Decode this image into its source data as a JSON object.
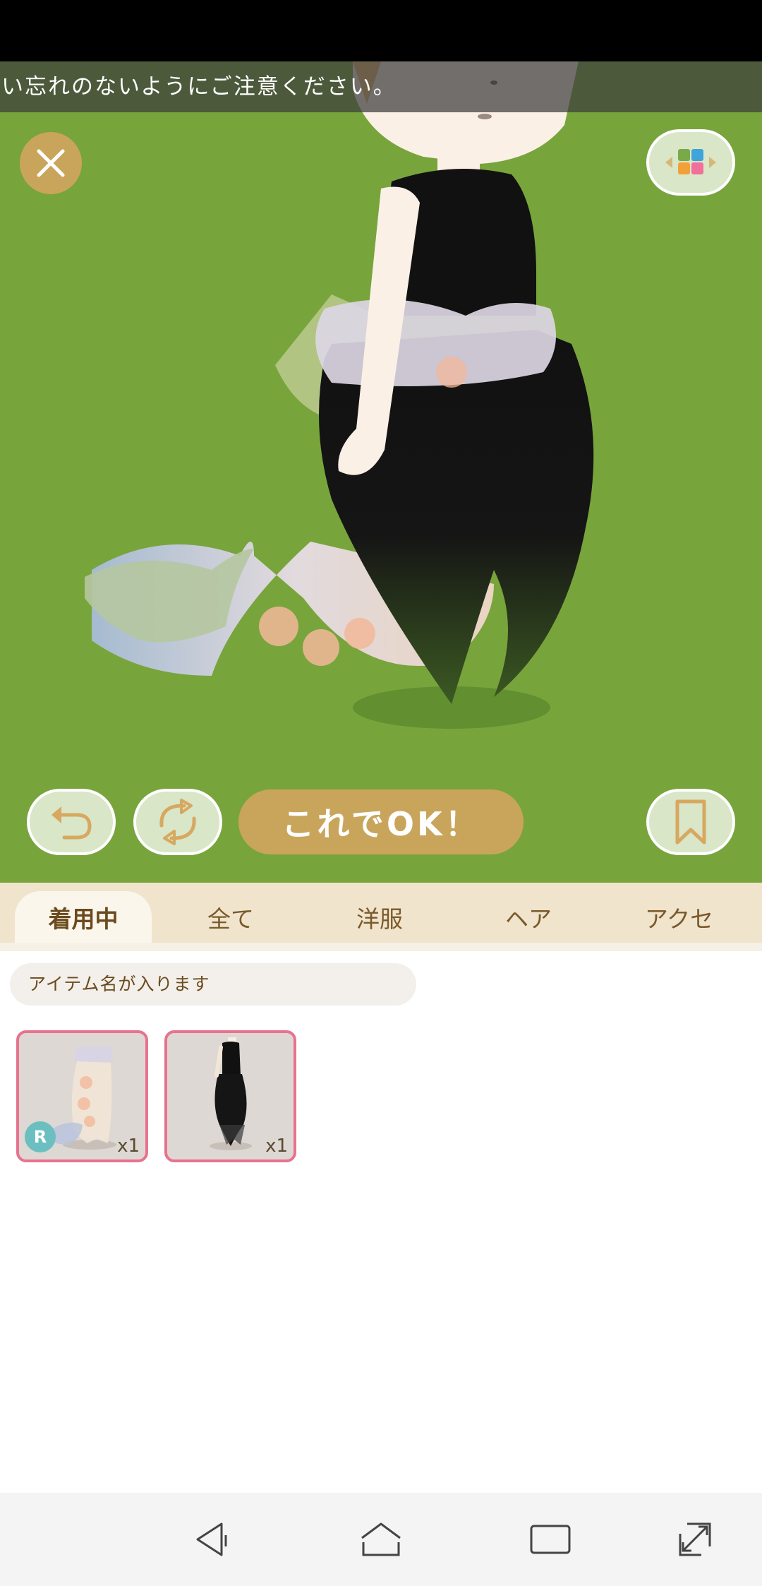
{
  "notice": {
    "text": "い忘れのないようにご注意ください。"
  },
  "controls": {
    "ok_label": "これでOK！"
  },
  "tabs": [
    {
      "label": "着用中",
      "active": true
    },
    {
      "label": "全て",
      "active": false
    },
    {
      "label": "洋服",
      "active": false
    },
    {
      "label": "ヘア",
      "active": false
    },
    {
      "label": "アクセ",
      "active": false
    }
  ],
  "item_name": {
    "placeholder": "アイテム名が入ります"
  },
  "items": [
    {
      "name": "mermaid-tail",
      "quantity": "x1",
      "rarity": "R"
    },
    {
      "name": "black-dress",
      "quantity": "x1"
    }
  ],
  "colors": {
    "stage_bg": "#78a43c",
    "accent_gold": "#c9a55c",
    "card_border": "#e8728e",
    "rarity_badge": "#6bbfc0"
  },
  "icons": {
    "close": "close-icon",
    "layout": "layout-grid-icon",
    "undo": "undo-icon",
    "cycle": "cycle-icon",
    "bookmark": "bookmark-icon",
    "nav_back": "back-triangle-icon",
    "nav_home": "home-icon",
    "nav_recent": "recent-apps-icon",
    "nav_expand": "expand-icon"
  }
}
